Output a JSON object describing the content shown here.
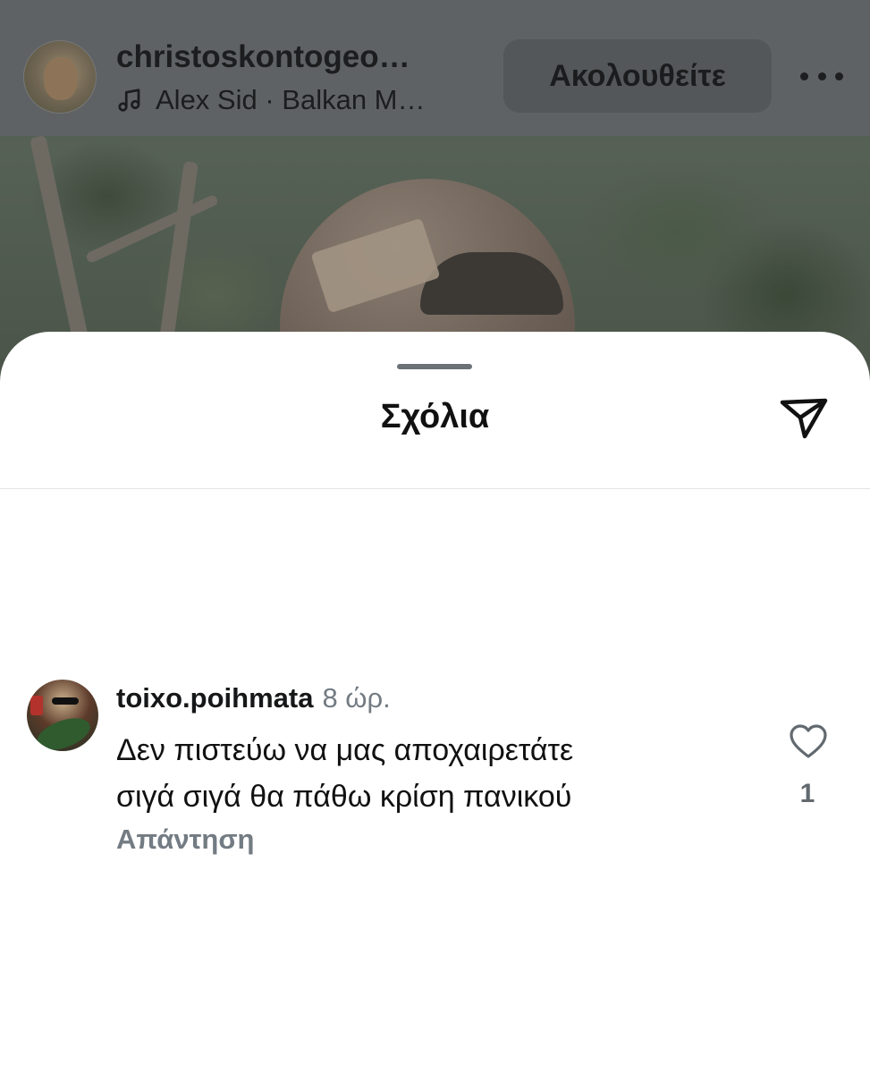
{
  "header": {
    "username": "christoskontogeo…",
    "music": "Alex Sid · Balkan M…",
    "follow_label": "Ακολουθείτε",
    "icons": {
      "avatar": "user-avatar",
      "music": "music-note-icon",
      "more": "more-horizontal-icon"
    }
  },
  "comments_sheet": {
    "title": "Σχόλια",
    "share_icon": "send-icon",
    "comments": [
      {
        "username": "toixo.poihmata",
        "time": "8 ώρ.",
        "text_line1": "Δεν πιστεύω να μας αποχαιρετάτε",
        "text_line2": "σιγά σιγά θα πάθω κρίση πανικού",
        "reply_label": "Απάντηση",
        "like_count": "1",
        "like_icon": "heart-outline-icon"
      }
    ]
  },
  "colors": {
    "overlay": "#5e6264",
    "secondary_text": "#737b83",
    "sheet_bg": "#ffffff"
  }
}
